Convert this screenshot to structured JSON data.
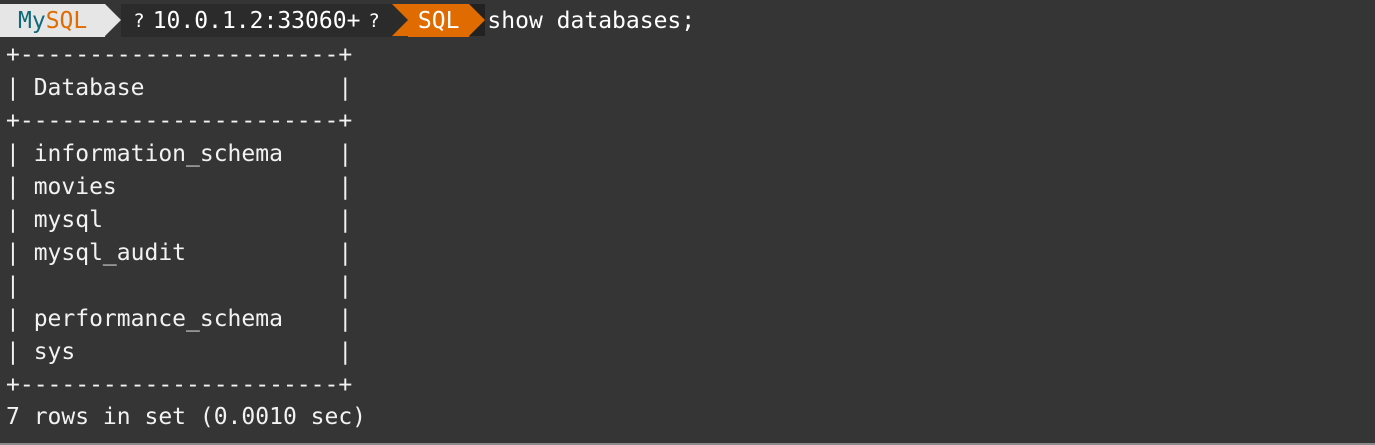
{
  "prompt": {
    "mode_prefix": "My",
    "mode_suffix": "SQL",
    "host_icon": "?",
    "host": "10.0.1.2:33060+",
    "path_icon": "?",
    "language": "SQL",
    "command": "show databases;"
  },
  "output": {
    "border": "+-----------------------+",
    "header_row": "| Database              |",
    "rows": [
      "| information_schema    |",
      "| movies                |",
      "| mysql                 |",
      "| mysql_audit           |",
      "|                       |",
      "| performance_schema    |",
      "| sys                   |"
    ],
    "footer": "7 rows in set (0.0010 sec)"
  },
  "colors": {
    "background": "#353535",
    "prompt_light": "#e6e6e6",
    "prompt_teal": "#0f6a78",
    "prompt_orange": "#e06b00",
    "text": "#f2f2f2"
  }
}
